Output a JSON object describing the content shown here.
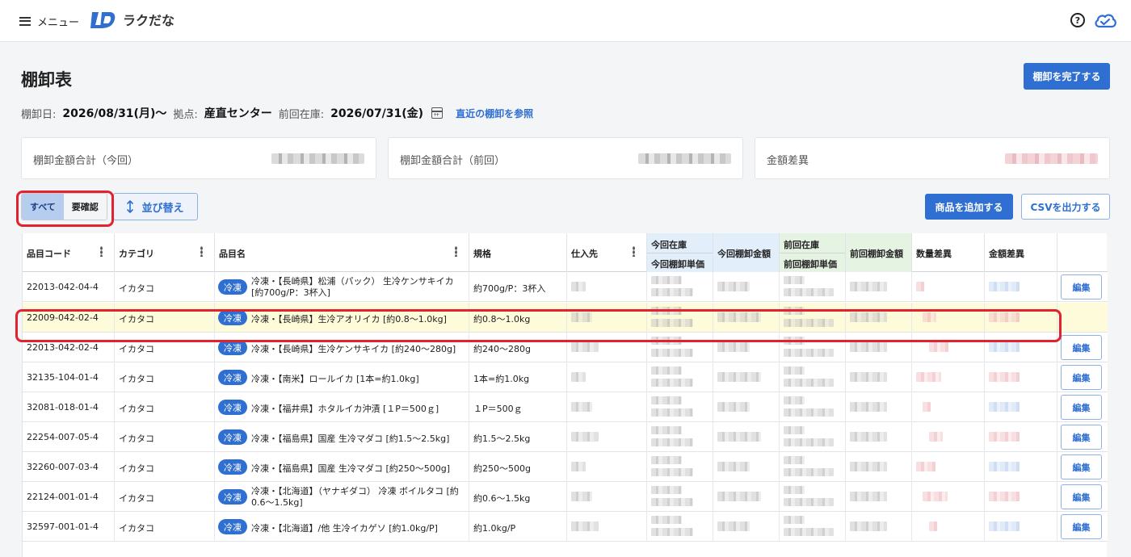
{
  "header": {
    "menu_label": "メニュー",
    "brand": "ラクだな"
  },
  "page": {
    "title": "棚卸表",
    "complete_button": "棚卸を完了する",
    "meta": {
      "date_label": "棚卸日:",
      "date_value": "2026/08/31(月)〜",
      "site_label": "拠点:",
      "site_value": "産直センター",
      "prev_label": "前回在庫:",
      "prev_value": "2026/07/31(金)",
      "ref_link": "直近の棚卸を参照"
    },
    "summary": [
      {
        "label": "棚卸金額合計（今回）"
      },
      {
        "label": "棚卸金額合計（前回）"
      },
      {
        "label": "金額差異"
      }
    ],
    "toolbar": {
      "filter_all": "すべて",
      "filter_review": "要確認",
      "sort_button": "並び替え",
      "add_button": "商品を追加する",
      "csv_button": "CSVを出力する"
    }
  },
  "table": {
    "headers": {
      "code": "品目コード",
      "category": "カテゴリ",
      "name": "品目名",
      "spec": "規格",
      "supplier": "仕入先",
      "cur_stock": "今回在庫",
      "cur_unit": "今回棚卸単価",
      "cur_amount": "今回棚卸金額",
      "prev_stock": "前回在庫",
      "prev_unit": "前回棚卸単価",
      "prev_amount": "前回棚卸金額",
      "qty_diff": "数量差異",
      "amt_diff": "金額差異"
    },
    "edit_label": "編集",
    "rows": [
      {
        "code": "22013-042-04-4",
        "category": "イカタコ",
        "tag": "冷凍",
        "name": "冷凍・【長崎県】松浦（パック） 生冷ケンサキイカ [約700g/P：3杯入]",
        "spec": "約700g/P：3杯入"
      },
      {
        "code": "22009-042-02-4",
        "category": "イカタコ",
        "tag": "冷凍",
        "name": "冷凍・【長崎県】生冷アオリイカ [約0.8〜1.0kg]",
        "spec": "約0.8〜1.0kg"
      },
      {
        "code": "22013-042-02-4",
        "category": "イカタコ",
        "tag": "冷凍",
        "name": "冷凍・【長崎県】生冷ケンサキイカ [約240〜280g]",
        "spec": "約240〜280g"
      },
      {
        "code": "32135-104-01-4",
        "category": "イカタコ",
        "tag": "冷凍",
        "name": "冷凍・【南米】ロールイカ [1本=約1.0kg]",
        "spec": "1本=約1.0kg"
      },
      {
        "code": "32081-018-01-4",
        "category": "イカタコ",
        "tag": "冷凍",
        "name": "冷凍・【福井県】ホタルイカ沖漬 [１P＝500ｇ]",
        "spec": "１P＝500ｇ"
      },
      {
        "code": "22254-007-05-4",
        "category": "イカタコ",
        "tag": "冷凍",
        "name": "冷凍・【福島県】国産 生冷マダコ [約1.5〜2.5kg]",
        "spec": "約1.5〜2.5kg"
      },
      {
        "code": "32260-007-03-4",
        "category": "イカタコ",
        "tag": "冷凍",
        "name": "冷凍・【福島県】国産 生冷マダコ [約250〜500g]",
        "spec": "約250〜500g"
      },
      {
        "code": "22124-001-01-4",
        "category": "イカタコ",
        "tag": "冷凍",
        "name": "冷凍・【北海道】（ヤナギダコ） 冷凍 ボイルタコ [約0.6〜1.5kg]",
        "spec": "約0.6〜1.5kg"
      },
      {
        "code": "32597-001-01-4",
        "category": "イカタコ",
        "tag": "冷凍",
        "name": "冷凍・【北海道】/他 生冷イカゲソ [約1.0kg/P]",
        "spec": "約1.0kg/P"
      }
    ]
  }
}
